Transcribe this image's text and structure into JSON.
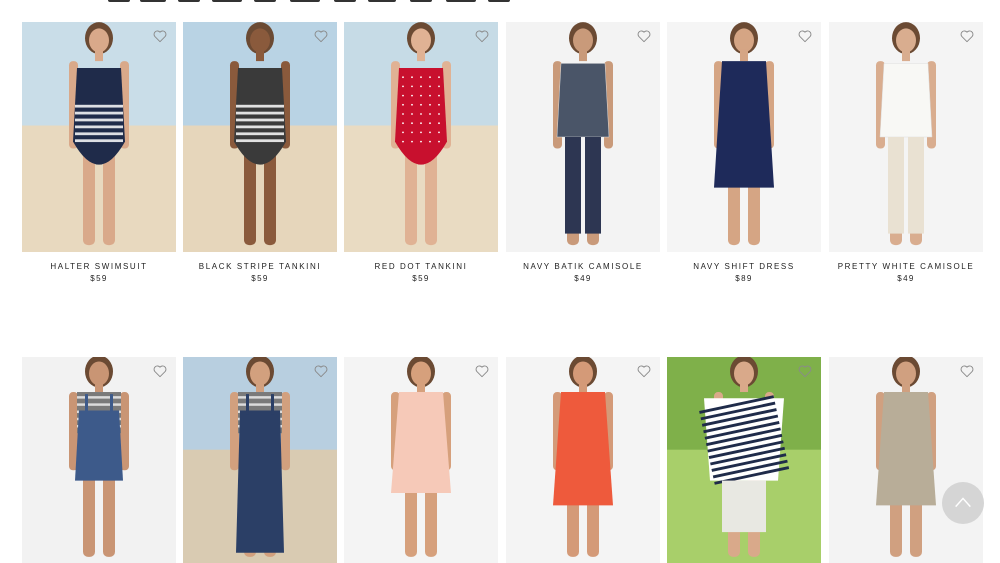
{
  "products": [
    {
      "title": "HALTER SWIMSUIT",
      "price": "$59",
      "bg": "#c9dde8",
      "sand": "#e8d9bf",
      "garment": "#1f2b4a",
      "skin": "#d9a98a",
      "style": "swim-stripe"
    },
    {
      "title": "BLACK STRIPE TANKINI",
      "price": "$59",
      "bg": "#b9d3e4",
      "sand": "#e6d6bb",
      "garment": "#3a3a3a",
      "skin": "#8a5a3c",
      "style": "swim-stripe"
    },
    {
      "title": "RED DOT TANKINI",
      "price": "$59",
      "bg": "#c6dbe6",
      "sand": "#e9dbc2",
      "garment": "#c8102e",
      "skin": "#e0b294",
      "style": "swim"
    },
    {
      "title": "NAVY BATIK CAMISOLE",
      "price": "$49",
      "bg": "#f3f3f3",
      "sand": "#f3f3f3",
      "garment": "#4a5568",
      "skin": "#c99a7a",
      "style": "top-pants"
    },
    {
      "title": "NAVY SHIFT DRESS",
      "price": "$89",
      "bg": "#f5f5f5",
      "sand": "#f5f5f5",
      "garment": "#1e2a5a",
      "skin": "#d5a584",
      "style": "dress"
    },
    {
      "title": "PRETTY WHITE CAMISOLE",
      "price": "$49",
      "bg": "#f4f4f4",
      "sand": "#f4f4f4",
      "garment": "#f8f8f5",
      "skin": "#d9ad8f",
      "style": "top-pants-light"
    },
    {
      "title": "",
      "price": "",
      "bg": "#f2f2f2",
      "sand": "#f2f2f2",
      "garment": "#3d5a8a",
      "skin": "#c99574",
      "style": "overall-short"
    },
    {
      "title": "",
      "price": "",
      "bg": "#b8cfe0",
      "sand": "#d9cbb2",
      "garment": "#2b3f66",
      "skin": "#d2a07e",
      "style": "overall-long"
    },
    {
      "title": "",
      "price": "",
      "bg": "#f4f4f4",
      "sand": "#f4f4f4",
      "garment": "#f6c9b8",
      "skin": "#d6a07c",
      "style": "dress-short"
    },
    {
      "title": "",
      "price": "",
      "bg": "#f4f4f4",
      "sand": "#f4f4f4",
      "garment": "#ee5a3c",
      "skin": "#d49a78",
      "style": "dress"
    },
    {
      "title": "",
      "price": "",
      "bg": "#7fb04a",
      "sand": "#a8cf6a",
      "garment": "#1f2b4a",
      "skin": "#d9a98a",
      "style": "stripe-top"
    },
    {
      "title": "",
      "price": "",
      "bg": "#f3f3f3",
      "sand": "#f3f3f3",
      "garment": "#b8ad98",
      "skin": "#d0a080",
      "style": "dress"
    }
  ],
  "icons": {
    "wishlist": "heart-outline-icon",
    "scroll_top": "chevron-up-icon"
  }
}
